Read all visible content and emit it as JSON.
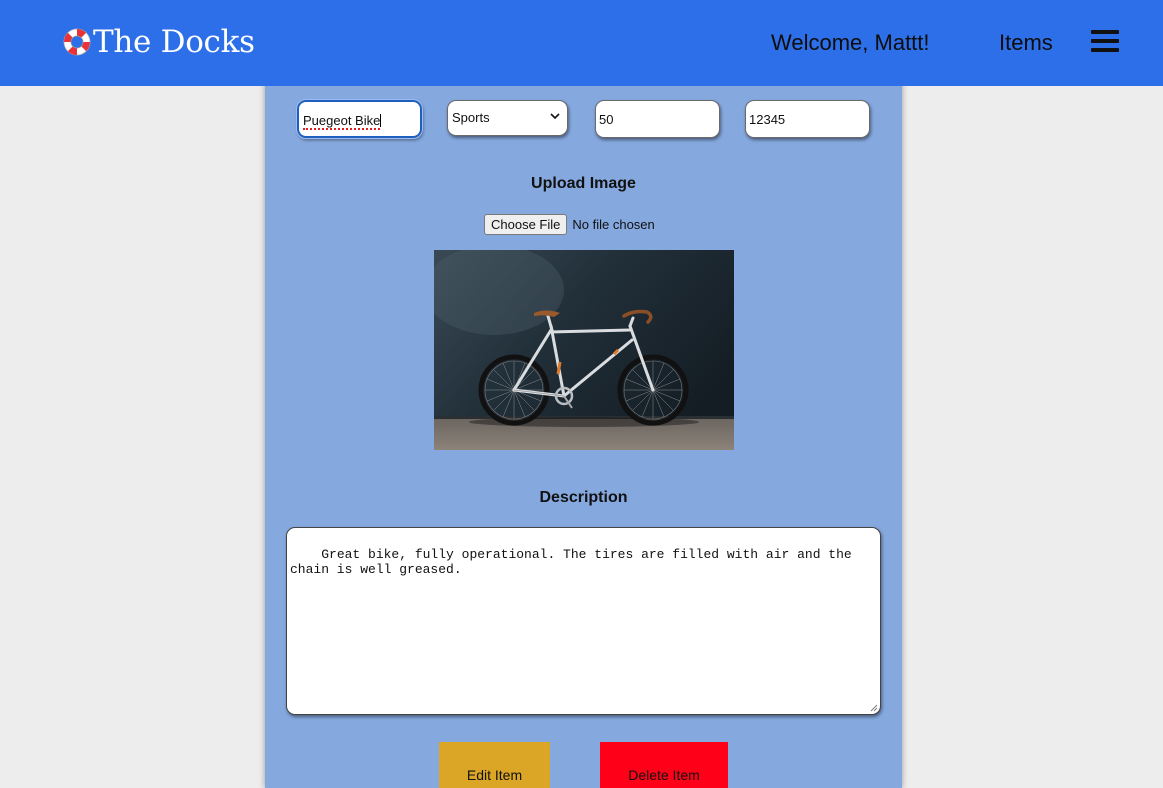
{
  "navbar": {
    "brand": "The Docks",
    "brand_icon": "lifebuoy-icon",
    "welcome": "Welcome, Mattt!",
    "items_link": "Items",
    "menu_icon": "hamburger-menu-icon",
    "background": "#2d6fe8"
  },
  "form": {
    "item_name": "Puegeot Bike",
    "category": {
      "selected": "Sports"
    },
    "price": "50",
    "zip": "12345",
    "upload_label": "Upload Image",
    "file_button": "Choose File",
    "file_status": "No file chosen",
    "image_subject": "bicycle-photo",
    "description_label": "Description",
    "description": "Great bike, fully operational. The tires are filled with air and the chain is well greased."
  },
  "actions": {
    "edit_label": "Edit Item",
    "delete_label": "Delete Item",
    "edit_color": "#dba626",
    "delete_color": "#ff0019"
  }
}
